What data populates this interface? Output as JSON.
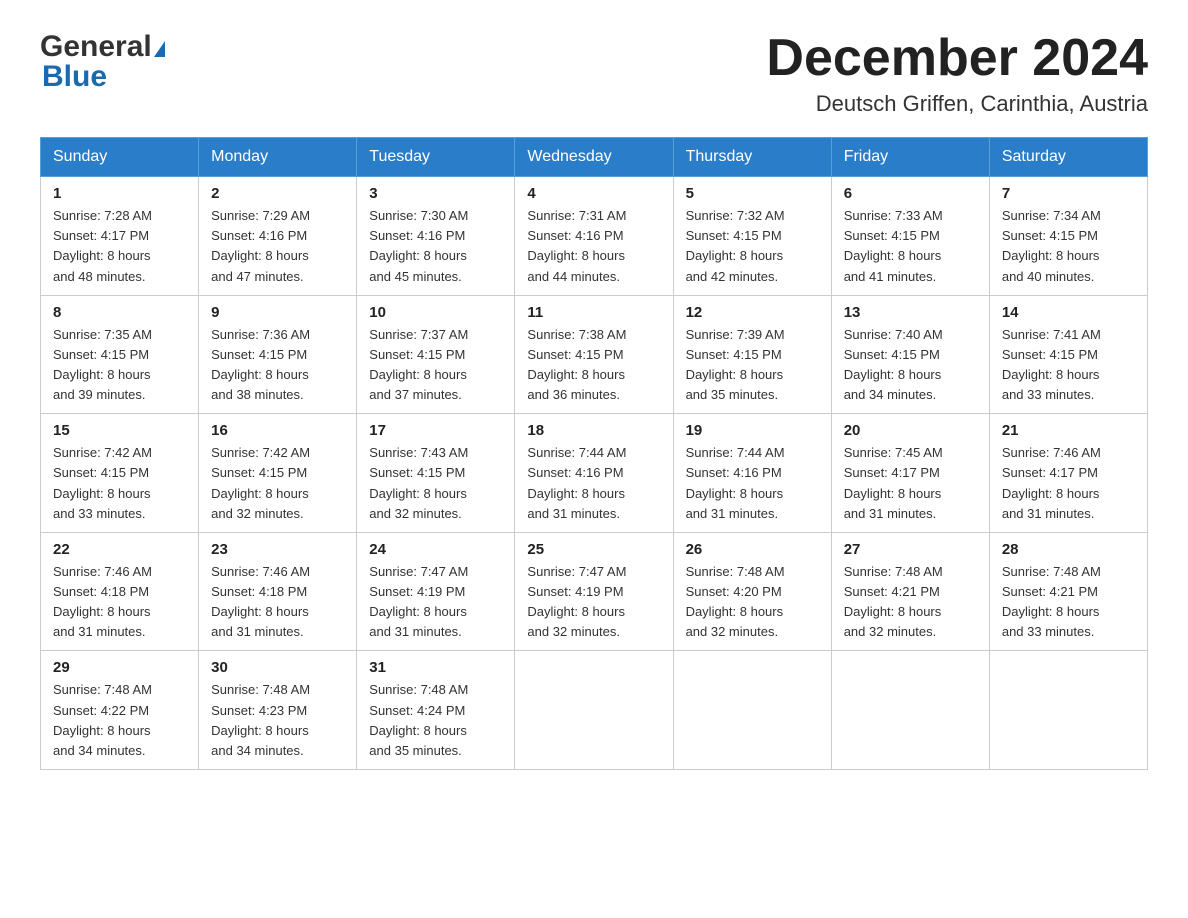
{
  "header": {
    "logo_general": "General",
    "logo_blue": "Blue",
    "month_title": "December 2024",
    "location": "Deutsch Griffen, Carinthia, Austria"
  },
  "weekdays": [
    "Sunday",
    "Monday",
    "Tuesday",
    "Wednesday",
    "Thursday",
    "Friday",
    "Saturday"
  ],
  "weeks": [
    [
      {
        "day": "1",
        "sunrise": "7:28 AM",
        "sunset": "4:17 PM",
        "daylight": "8 hours and 48 minutes."
      },
      {
        "day": "2",
        "sunrise": "7:29 AM",
        "sunset": "4:16 PM",
        "daylight": "8 hours and 47 minutes."
      },
      {
        "day": "3",
        "sunrise": "7:30 AM",
        "sunset": "4:16 PM",
        "daylight": "8 hours and 45 minutes."
      },
      {
        "day": "4",
        "sunrise": "7:31 AM",
        "sunset": "4:16 PM",
        "daylight": "8 hours and 44 minutes."
      },
      {
        "day": "5",
        "sunrise": "7:32 AM",
        "sunset": "4:15 PM",
        "daylight": "8 hours and 42 minutes."
      },
      {
        "day": "6",
        "sunrise": "7:33 AM",
        "sunset": "4:15 PM",
        "daylight": "8 hours and 41 minutes."
      },
      {
        "day": "7",
        "sunrise": "7:34 AM",
        "sunset": "4:15 PM",
        "daylight": "8 hours and 40 minutes."
      }
    ],
    [
      {
        "day": "8",
        "sunrise": "7:35 AM",
        "sunset": "4:15 PM",
        "daylight": "8 hours and 39 minutes."
      },
      {
        "day": "9",
        "sunrise": "7:36 AM",
        "sunset": "4:15 PM",
        "daylight": "8 hours and 38 minutes."
      },
      {
        "day": "10",
        "sunrise": "7:37 AM",
        "sunset": "4:15 PM",
        "daylight": "8 hours and 37 minutes."
      },
      {
        "day": "11",
        "sunrise": "7:38 AM",
        "sunset": "4:15 PM",
        "daylight": "8 hours and 36 minutes."
      },
      {
        "day": "12",
        "sunrise": "7:39 AM",
        "sunset": "4:15 PM",
        "daylight": "8 hours and 35 minutes."
      },
      {
        "day": "13",
        "sunrise": "7:40 AM",
        "sunset": "4:15 PM",
        "daylight": "8 hours and 34 minutes."
      },
      {
        "day": "14",
        "sunrise": "7:41 AM",
        "sunset": "4:15 PM",
        "daylight": "8 hours and 33 minutes."
      }
    ],
    [
      {
        "day": "15",
        "sunrise": "7:42 AM",
        "sunset": "4:15 PM",
        "daylight": "8 hours and 33 minutes."
      },
      {
        "day": "16",
        "sunrise": "7:42 AM",
        "sunset": "4:15 PM",
        "daylight": "8 hours and 32 minutes."
      },
      {
        "day": "17",
        "sunrise": "7:43 AM",
        "sunset": "4:15 PM",
        "daylight": "8 hours and 32 minutes."
      },
      {
        "day": "18",
        "sunrise": "7:44 AM",
        "sunset": "4:16 PM",
        "daylight": "8 hours and 31 minutes."
      },
      {
        "day": "19",
        "sunrise": "7:44 AM",
        "sunset": "4:16 PM",
        "daylight": "8 hours and 31 minutes."
      },
      {
        "day": "20",
        "sunrise": "7:45 AM",
        "sunset": "4:17 PM",
        "daylight": "8 hours and 31 minutes."
      },
      {
        "day": "21",
        "sunrise": "7:46 AM",
        "sunset": "4:17 PM",
        "daylight": "8 hours and 31 minutes."
      }
    ],
    [
      {
        "day": "22",
        "sunrise": "7:46 AM",
        "sunset": "4:18 PM",
        "daylight": "8 hours and 31 minutes."
      },
      {
        "day": "23",
        "sunrise": "7:46 AM",
        "sunset": "4:18 PM",
        "daylight": "8 hours and 31 minutes."
      },
      {
        "day": "24",
        "sunrise": "7:47 AM",
        "sunset": "4:19 PM",
        "daylight": "8 hours and 31 minutes."
      },
      {
        "day": "25",
        "sunrise": "7:47 AM",
        "sunset": "4:19 PM",
        "daylight": "8 hours and 32 minutes."
      },
      {
        "day": "26",
        "sunrise": "7:48 AM",
        "sunset": "4:20 PM",
        "daylight": "8 hours and 32 minutes."
      },
      {
        "day": "27",
        "sunrise": "7:48 AM",
        "sunset": "4:21 PM",
        "daylight": "8 hours and 32 minutes."
      },
      {
        "day": "28",
        "sunrise": "7:48 AM",
        "sunset": "4:21 PM",
        "daylight": "8 hours and 33 minutes."
      }
    ],
    [
      {
        "day": "29",
        "sunrise": "7:48 AM",
        "sunset": "4:22 PM",
        "daylight": "8 hours and 34 minutes."
      },
      {
        "day": "30",
        "sunrise": "7:48 AM",
        "sunset": "4:23 PM",
        "daylight": "8 hours and 34 minutes."
      },
      {
        "day": "31",
        "sunrise": "7:48 AM",
        "sunset": "4:24 PM",
        "daylight": "8 hours and 35 minutes."
      },
      null,
      null,
      null,
      null
    ]
  ],
  "labels": {
    "sunrise_prefix": "Sunrise: ",
    "sunset_prefix": "Sunset: ",
    "daylight_prefix": "Daylight: "
  }
}
